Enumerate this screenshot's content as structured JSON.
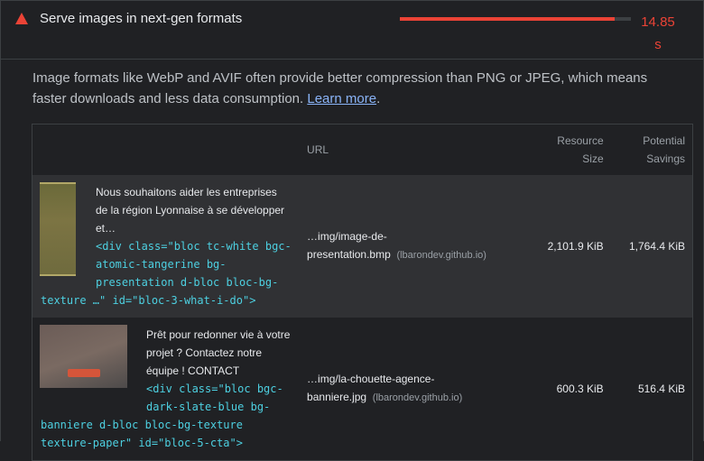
{
  "audit": {
    "title": "Serve images in next-gen formats",
    "savings_value": "14.85",
    "savings_unit": "s",
    "savings_fraction": 0.93,
    "accent_color": "#eb4336"
  },
  "description": {
    "text": "Image formats like WebP and AVIF often provide better compression than PNG or JPEG, which means faster downloads and less data consumption.",
    "link_label": "Learn more",
    "trailing": "."
  },
  "table": {
    "headers": {
      "url": "URL",
      "resource_size_line1": "Resource",
      "resource_size_line2": "Size",
      "potential_savings_line1": "Potential",
      "potential_savings_line2": "Savings"
    },
    "rows": [
      {
        "snippet_text": "Nous souhaitons aider les entreprises de la région Lyonnaise à se développer et…",
        "snippet_code_a": "<div class=\"bloc tc-white bgc-",
        "snippet_code_b": "atomic-tangerine bg-",
        "snippet_code_c": "presentation d-bloc bloc-bg-",
        "snippet_code_d": "texture …\" id=\"bloc-3-what-i-do\">",
        "url_line1": "…img/image-de-",
        "url_line2": "presentation.bmp",
        "origin": "(lbarondev.github.io)",
        "resource_size": "2,101.9 KiB",
        "potential_savings": "1,764.4 KiB"
      },
      {
        "snippet_text": "Prêt pour redonner vie à votre projet ? Contactez notre équipe ! CONTACT",
        "snippet_code_a": "<div class=\"bloc bgc-",
        "snippet_code_b": "dark-slate-blue bg-",
        "snippet_code_c": "banniere d-bloc bloc-bg-texture",
        "snippet_code_d": "texture-paper\" id=\"bloc-5-cta\">",
        "url_line1": "…img/la-chouette-agence-",
        "url_line2": "banniere.jpg",
        "origin": "(lbarondev.github.io)",
        "resource_size": "600.3 KiB",
        "potential_savings": "516.4 KiB"
      }
    ]
  }
}
